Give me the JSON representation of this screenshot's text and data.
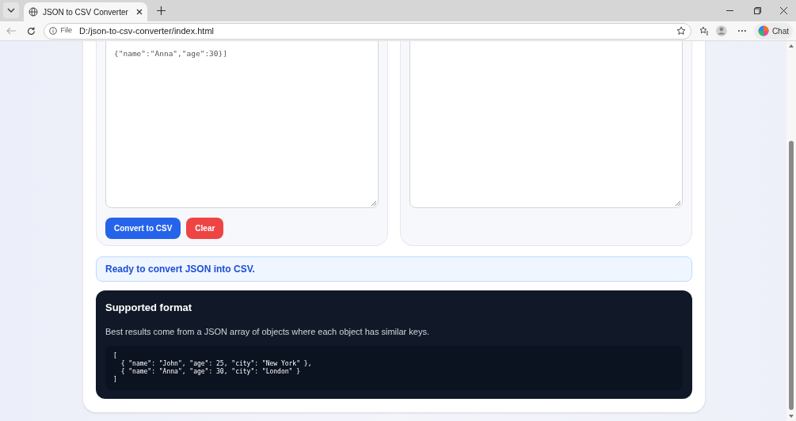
{
  "browser": {
    "tab_title": "JSON to CSV Converter",
    "address_prefix": "File",
    "url": "D:/json-to-csv-converter/index.html",
    "chat_label": "Chat"
  },
  "input": {
    "visible_text": "{\"name\":\"Anna\",\"age\":30}]"
  },
  "buttons": [
    {
      "label": "Convert to CSV",
      "kind": "primary"
    },
    {
      "label": "Clear",
      "kind": "danger"
    }
  ],
  "status": "Ready to convert JSON into CSV.",
  "info": {
    "title": "Supported format",
    "description": "Best results come from a JSON array of objects where each object has similar keys.",
    "code": [
      "[",
      "  { \"name\": \"John\", \"age\": 25, \"city\": \"New York\" },",
      "  { \"name\": \"Anna\", \"age\": 30, \"city\": \"London\" }",
      "]"
    ]
  }
}
